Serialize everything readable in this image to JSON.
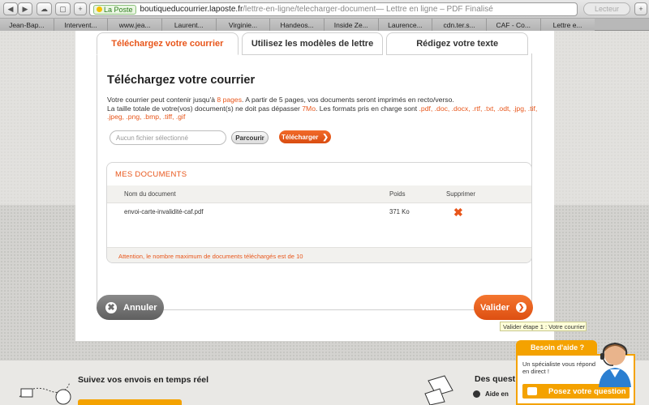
{
  "browser": {
    "back": "◀",
    "forward": "▶",
    "cloud": "☁",
    "share": "▢",
    "plus": "+",
    "site_badge": "La Poste",
    "url_host": "boutiqueducourrier.laposte.fr",
    "url_path": "/lettre-en-ligne/telecharger-document",
    "page_title": " — Lettre en ligne – PDF Finalisé",
    "reader": "Lecteur",
    "tabs": [
      "Jean-Bap...",
      "Intervent...",
      "www.jea...",
      "Laurent...",
      "Virginie...",
      "Handeos...",
      "Inside Ze...",
      "Laurence...",
      "cdn.ter.s...",
      "CAF - Co...",
      "Lettre e..."
    ]
  },
  "steps": {
    "tab1": "Téléchargez votre courrier",
    "tab2": "Utilisez les modèles de lettre",
    "tab3": "Rédigez votre texte"
  },
  "main": {
    "heading": "Téléchargez votre courrier",
    "desc1a": "Votre courrier peut contenir jusqu'à ",
    "desc1b": "8 pages",
    "desc1c": ". A partir de 5 pages, vos documents seront imprimés en recto/verso.",
    "desc2a": "La taille totale de votre(vos) document(s) ne doit pas dépasser ",
    "desc2b": "7Mo",
    "desc2c": ". Les formats pris en charge sont ",
    "desc2d": ".pdf, .doc, .docx, .rtf, .txt, .odt, .jpg, .tif, .jpeg, .png, .bmp, .tiff, .gif",
    "file_placeholder": "Aucun fichier sélectionné",
    "browse": "Parcourir",
    "upload": "Télécharger"
  },
  "documents": {
    "title": "MES DOCUMENTS",
    "columns": {
      "name": "Nom du document",
      "size": "Poids",
      "delete": "Supprimer"
    },
    "rows": [
      {
        "name": "envoi-carte-invalidité-caf.pdf",
        "size": "371 Ko"
      }
    ],
    "warning": "Attention, le nombre maximum de documents téléchargés est de 10"
  },
  "actions": {
    "cancel": "Annuler",
    "validate": "Valider",
    "tooltip": "Valider étape 1 : Votre courrier"
  },
  "footer": {
    "tracking": "Suivez vos envois en temps réel",
    "questions": "Des quest",
    "aide": "Aide en"
  },
  "help": {
    "tab": "Besoin d'aide ?",
    "text": "Un spécialiste vous répond en direct !",
    "ask": "Posez votre question"
  },
  "colors": {
    "accent": "#e8561b",
    "help": "#f4a200",
    "grey_button": "#6d6d6d"
  }
}
